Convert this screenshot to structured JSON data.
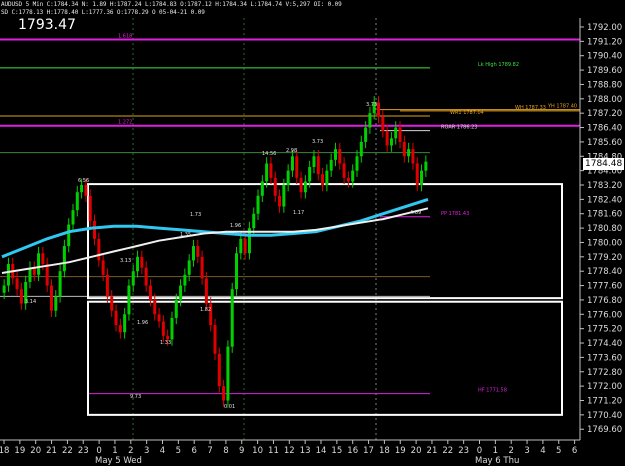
{
  "header": {
    "info": "AUDUSD 5 Min  C:1784.34  N: 1.89  H:1787.24  L:1784.83  O:1787.12  H:1784.34  L:1784.74  V:5,297  OI: 0.09"
  },
  "subheader": {
    "info": "SD  C:1778.13  H:1778.40  L:1777.36  O:1778.29  O 05-04-21  0.09"
  },
  "current_price_label": "1793.47",
  "current_price_tag": "1784.48",
  "date_labels": [
    "May 5 Wed",
    "May 6 Thu"
  ],
  "colors": {
    "candle_up": "#00d000",
    "candle_down": "#e00000",
    "magenta": "#e020e0",
    "green_line": "#40e040",
    "orange": "#e0a020",
    "cyan_ma": "#30c8f0",
    "white_ma": "#f0f0f0"
  },
  "chart_data": {
    "type": "candlestick",
    "ylim": [
      1769.0,
      1792.5
    ],
    "y_ticks": [
      1792.0,
      1791.2,
      1790.4,
      1789.6,
      1788.8,
      1788.0,
      1787.2,
      1786.4,
      1785.6,
      1784.8,
      1784.0,
      1783.2,
      1782.4,
      1781.6,
      1780.8,
      1780.0,
      1779.2,
      1778.4,
      1777.6,
      1776.8,
      1776.0,
      1775.2,
      1774.4,
      1773.6,
      1772.8,
      1772.0,
      1771.2,
      1770.4,
      1769.6
    ],
    "y_tick_labels": [
      "1792.00",
      "1791.20",
      "1790.40",
      "1789.60",
      "1788.80",
      "1788.00",
      "1787.20",
      "1786.40",
      "1785.60",
      "1784.80",
      "1784.00",
      "1783.20",
      "1782.40",
      "1781.60",
      "1780.80",
      "1780.00",
      "1779.20",
      "1778.40",
      "1777.60",
      "1776.80",
      "1776.00",
      "1775.20",
      "1774.40",
      "1773.60",
      "1772.80",
      "1772.00",
      "1771.20",
      "1770.40",
      "1769.60"
    ],
    "x_ticks": [
      "18",
      "19",
      "20",
      "21",
      "22",
      "23",
      "0",
      "1",
      "2",
      "3",
      "4",
      "5",
      "6",
      "7",
      "8",
      "9",
      "10",
      "11",
      "12",
      "13",
      "14",
      "15",
      "16",
      "17",
      "18",
      "19",
      "20",
      "21",
      "22",
      "23",
      "0",
      "1",
      "2",
      "3",
      "4",
      "5",
      "6"
    ],
    "close": [
      1777.6,
      1778.8,
      1778.0,
      1777.4,
      1776.6,
      1777.8,
      1778.6,
      1778.2,
      1779.4,
      1778.8,
      1777.6,
      1776.2,
      1777.0,
      1778.4,
      1779.8,
      1781.0,
      1781.8,
      1782.8,
      1783.2,
      1782.6,
      1781.2,
      1780.2,
      1779.0,
      1778.2,
      1777.0,
      1776.2,
      1775.4,
      1775.0,
      1776.0,
      1777.6,
      1778.4,
      1779.2,
      1778.6,
      1777.6,
      1776.8,
      1776.0,
      1775.6,
      1774.8,
      1774.6,
      1775.8,
      1776.8,
      1777.6,
      1778.2,
      1779.0,
      1779.8,
      1779.2,
      1778.0,
      1776.6,
      1775.4,
      1773.8,
      1772.0,
      1771.2,
      1774.2,
      1777.4,
      1779.4,
      1780.2,
      1779.4,
      1780.8,
      1781.6,
      1782.6,
      1783.4,
      1784.4,
      1783.6,
      1782.6,
      1782.0,
      1783.2,
      1784.0,
      1784.8,
      1783.6,
      1782.8,
      1783.4,
      1784.2,
      1784.8,
      1783.8,
      1783.2,
      1784.0,
      1784.6,
      1785.2,
      1784.4,
      1783.6,
      1783.4,
      1784.0,
      1784.8,
      1785.6,
      1786.4,
      1787.2,
      1787.8,
      1787.0,
      1786.2,
      1785.4,
      1785.8,
      1786.4,
      1785.6,
      1784.8,
      1785.2,
      1784.4,
      1783.2,
      1784.0,
      1784.5
    ],
    "moving_averages": [
      {
        "color": "cyan",
        "values": [
          1779.2,
          1779.7,
          1780.2,
          1780.6,
          1780.8,
          1780.9,
          1780.9,
          1780.8,
          1780.7,
          1780.6,
          1780.5,
          1780.4,
          1780.4,
          1780.5,
          1780.6,
          1780.9,
          1781.2,
          1781.6,
          1782.0,
          1782.4
        ]
      },
      {
        "color": "white",
        "values": [
          1778.3,
          1778.5,
          1778.7,
          1778.9,
          1779.2,
          1779.5,
          1779.8,
          1780.1,
          1780.3,
          1780.5,
          1780.6,
          1780.6,
          1780.6,
          1780.6,
          1780.7,
          1780.9,
          1781.1,
          1781.3,
          1781.6,
          1781.9
        ]
      }
    ],
    "levels": [
      {
        "value": 1791.3,
        "color": "magenta",
        "label": "1.618"
      },
      {
        "value": 1789.72,
        "color": "green",
        "label": "Lk High 1789.82"
      },
      {
        "value": 1787.4,
        "color": "orange",
        "label": "YH 1787.40"
      },
      {
        "value": 1787.04,
        "color": "orange",
        "label": "WR1 1787.04"
      },
      {
        "value": 1787.33,
        "color": "orange",
        "label": "WH 1787.33"
      },
      {
        "value": 1786.5,
        "color": "magenta",
        "label": "1.272"
      },
      {
        "value": 1786.23,
        "color": "white",
        "label": "ROAR 1786.23"
      },
      {
        "value": 1781.43,
        "color": "magenta",
        "label": "PP 1781.43"
      },
      {
        "value": 1771.58,
        "color": "magenta",
        "label": "HF 1771.58"
      }
    ],
    "annotations": [
      "6.56",
      "3.13",
      "3.14",
      "1.96",
      "1.33",
      "1.35",
      "1.82",
      "1.73",
      "1.96",
      "3.73",
      "1.17",
      "14.56",
      "2.98",
      "3.73",
      "4.69",
      "0.01",
      "9.73"
    ]
  }
}
